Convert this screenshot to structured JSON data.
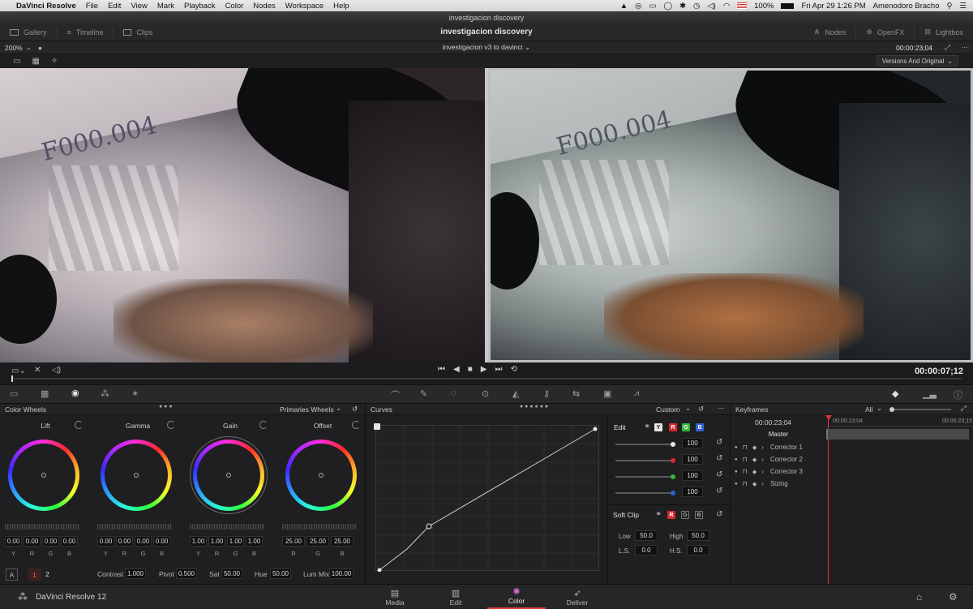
{
  "menubar": {
    "app": "DaVinci Resolve",
    "items": [
      "File",
      "Edit",
      "View",
      "Mark",
      "Playback",
      "Color",
      "Nodes",
      "Workspace",
      "Help"
    ],
    "battery": "100%",
    "datetime": "Fri Apr 29  1:26 PM",
    "user": "Amenodoro Bracho"
  },
  "window_title": "investigacion discovery",
  "topbar": {
    "gallery": "Gallery",
    "timeline": "Timeline",
    "clips": "Clips",
    "project_title": "investigacion discovery",
    "nodes": "Nodes",
    "openfx": "OpenFX",
    "lightbox": "Lightbox"
  },
  "viewerbar": {
    "zoom": "200%",
    "timeline_name": "investigacion v3 to davinci",
    "timecode": "00:00:23;04",
    "compare_mode": "Versions And Original"
  },
  "transport": {
    "timecode": "00:00:07;12"
  },
  "color_wheels": {
    "title": "Color Wheels",
    "mode": "Primaries Wheels",
    "wheels": [
      {
        "name": "Lift",
        "values": [
          "0.00",
          "0.00",
          "0.00",
          "0.00"
        ],
        "labels": [
          "Y",
          "R",
          "G",
          "B"
        ]
      },
      {
        "name": "Gamma",
        "values": [
          "0.00",
          "0.00",
          "0.00",
          "0.00"
        ],
        "labels": [
          "Y",
          "R",
          "G",
          "B"
        ]
      },
      {
        "name": "Gain",
        "values": [
          "1.00",
          "1.00",
          "1.00",
          "1.00"
        ],
        "labels": [
          "Y",
          "R",
          "G",
          "B"
        ]
      },
      {
        "name": "Offset",
        "values": [
          "25.00",
          "25.00",
          "25.00"
        ],
        "labels": [
          "R",
          "G",
          "B"
        ]
      }
    ],
    "params": {
      "a_label": "A",
      "page1": "1",
      "page2": "2",
      "contrast_label": "Contrast",
      "contrast": "1.000",
      "pivot_label": "Pivot",
      "pivot": "0.500",
      "sat_label": "Sat",
      "sat": "50.00",
      "hue_label": "Hue",
      "hue": "50.00",
      "lummix_label": "Lum Mix",
      "lummix": "100.00"
    }
  },
  "curves": {
    "title": "Curves",
    "mode": "Custom",
    "edit_label": "Edit",
    "channels": [
      "Y",
      "R",
      "G",
      "B"
    ],
    "channel_colors": [
      "#e6e6e6",
      "#d42b2b",
      "#37b637",
      "#2d62d6"
    ],
    "intensity": [
      "100",
      "100",
      "100",
      "100"
    ],
    "soft_clip_label": "Soft Clip",
    "low_label": "Low",
    "low": "50.0",
    "high_label": "High",
    "high": "50.0",
    "ls_label": "L.S.",
    "ls": "0.0",
    "hs_label": "H.S.",
    "hs": "0.0"
  },
  "keyframes": {
    "title": "Keyframes",
    "filter": "All",
    "timecode": "00:00:23;04",
    "ruler_start": "00:00:23;04",
    "ruler_end": "00:00:23;15",
    "tracks": [
      "Master",
      "Corrector 1",
      "Corrector 2",
      "Corrector 3",
      "Sizing"
    ]
  },
  "footer": {
    "app_name": "DaVinci Resolve 12",
    "tabs": [
      "Media",
      "Edit",
      "Color",
      "Deliver"
    ],
    "active_tab": "Color"
  }
}
